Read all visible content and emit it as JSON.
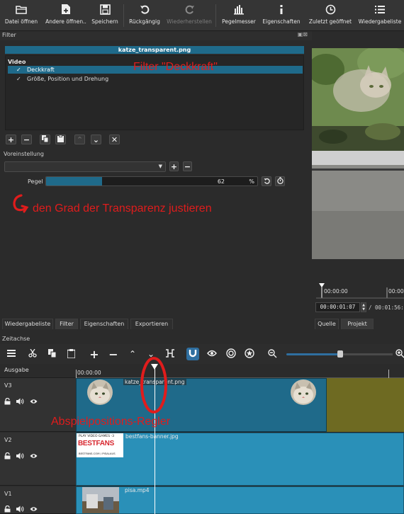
{
  "toolbar": {
    "items": [
      {
        "label": "Datei öffnen",
        "icon": "folder-open-icon",
        "enabled": true
      },
      {
        "label": "Andere öffnen..",
        "icon": "file-add-icon",
        "enabled": true
      },
      {
        "label": "Speichern",
        "icon": "save-icon",
        "enabled": true
      },
      {
        "label": "Rückgängig",
        "icon": "undo-icon",
        "enabled": true
      },
      {
        "label": "Wiederherstellen",
        "icon": "redo-icon",
        "enabled": false
      },
      {
        "label": "Pegelmesser",
        "icon": "level-meter-icon",
        "enabled": true
      },
      {
        "label": "Eigenschaften",
        "icon": "info-icon",
        "enabled": true
      },
      {
        "label": "Zuletzt geöffnet",
        "icon": "clock-icon",
        "enabled": true
      },
      {
        "label": "Wiedergabeliste",
        "icon": "list-icon",
        "enabled": true
      }
    ]
  },
  "filter": {
    "panel_title": "Filter",
    "clip_title": "katze_transparent.png",
    "category": "Video",
    "items": [
      {
        "check": "✓",
        "name": "Deckkraft",
        "selected": true
      },
      {
        "check": "✓",
        "name": "Größe, Position und Drehung",
        "selected": false
      }
    ],
    "preset_label": "Voreinstellung",
    "preset_value": "",
    "level_label": "Pegel",
    "level_value": "62",
    "level_unit": "%",
    "level_fraction": 0.62
  },
  "annotations": {
    "filter_name": "Filter \"Deckkraft\"",
    "transparency": "den Grad der Transparenz justieren",
    "playhead": "Abspielpositions-Regler"
  },
  "viewer": {
    "ruler_start": "00:00:00",
    "ruler_next": "00:00",
    "timecode": "00:00:01:07",
    "duration": "/ 00:01:56:16",
    "tabs": [
      "Quelle",
      "Projekt"
    ],
    "active_tab": "Projekt"
  },
  "dock_tabs": {
    "items": [
      "Wiedergabeliste",
      "Filter",
      "Eigenschaften",
      "Exportieren"
    ],
    "active": "Filter"
  },
  "timeline": {
    "title": "Zeitachse",
    "output_label": "Ausgabe",
    "ruler_start": "00:00:00",
    "playhead_time_fraction": 0.24,
    "tracks": [
      {
        "name": "V3",
        "clip": "katze_transparent.png"
      },
      {
        "name": "V2",
        "clip": "bestfans-banner.jpg"
      },
      {
        "name": "V1",
        "clip": "pisa.mp4"
      }
    ],
    "banner": {
      "line1": "PLAY VIDEO GAMES -3",
      "brand": "BESTFANS",
      "url": "BESTFANS.COM / PISALAUS"
    }
  },
  "colors": {
    "accent": "#1f6a8a",
    "track_v3_clip": "#1f6a8a",
    "track_v3_bg": "#6e6a22",
    "track_v2_clip": "#2a90b8",
    "annotation_red": "#e01c1c"
  }
}
